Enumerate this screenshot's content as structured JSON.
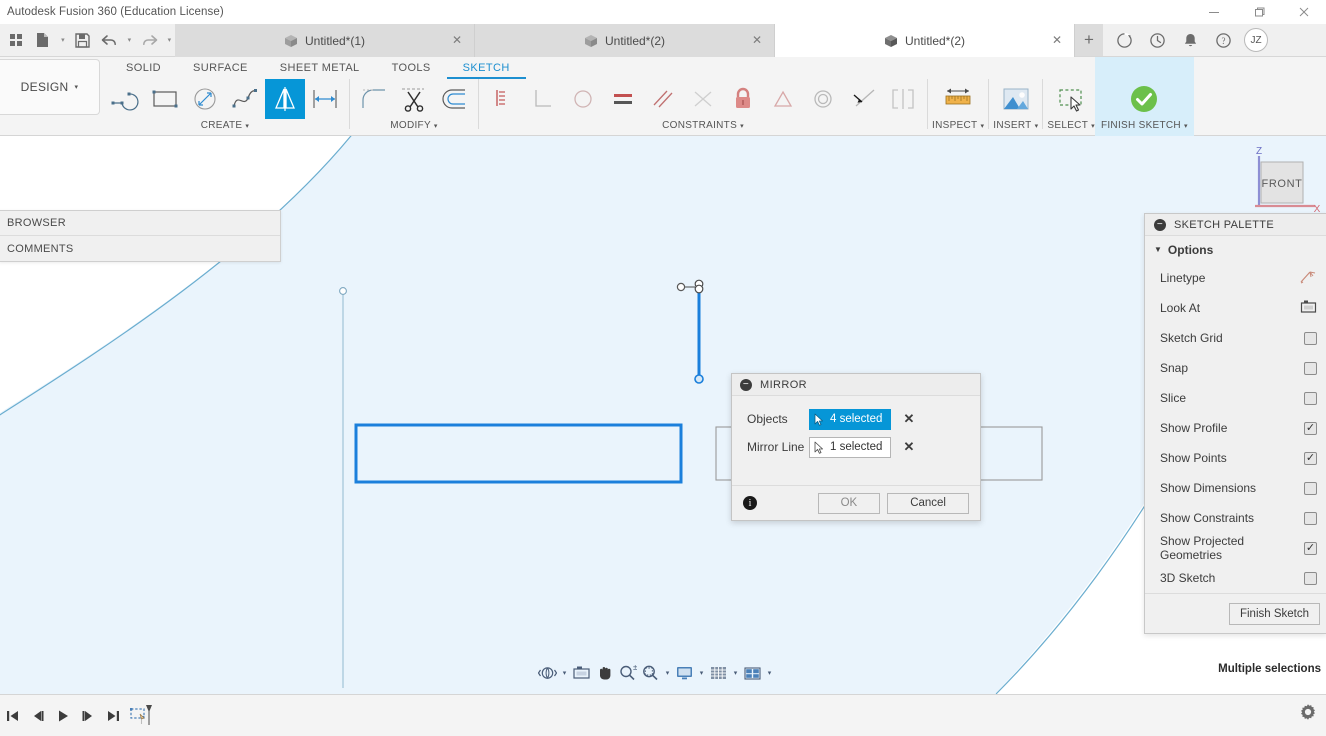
{
  "window": {
    "title": "Autodesk Fusion 360 (Education License)",
    "minimize": "—",
    "maximize": "❐",
    "close": "✕"
  },
  "quick_access": {
    "grid_label": "grid-menu-icon",
    "new_label": "new-document-icon",
    "save_label": "save-icon",
    "undo_label": "undo-icon",
    "redo_label": "redo-icon",
    "caret": "▾"
  },
  "tabs": [
    {
      "label": "Untitled*(1)",
      "active": false,
      "close": "✕"
    },
    {
      "label": "Untitled*(2)",
      "active": false,
      "close": "✕"
    },
    {
      "label": "Untitled*(2)",
      "active": true,
      "close": "✕"
    }
  ],
  "tab_actions": {
    "new_tab": "+",
    "job_status_icon": "job-status-icon",
    "recent_icon": "recent-icon",
    "notifications_icon": "notifications-icon",
    "help_icon": "help-icon",
    "avatar_initials": "JZ"
  },
  "ribbon": {
    "workspace": "DESIGN",
    "workspace_caret": "▾",
    "tabs": [
      {
        "label": "SOLID",
        "active": false
      },
      {
        "label": "SURFACE",
        "active": false
      },
      {
        "label": "SHEET METAL",
        "active": false
      },
      {
        "label": "TOOLS",
        "active": false
      },
      {
        "label": "SKETCH",
        "active": true
      }
    ],
    "groups": [
      {
        "label": "CREATE",
        "caret": "▾",
        "tools": [
          {
            "name": "line-tool",
            "selected": false
          },
          {
            "name": "rectangle-tool",
            "selected": false
          },
          {
            "name": "circle-tool",
            "selected": false
          },
          {
            "name": "spline-tool",
            "selected": false
          },
          {
            "name": "mirror-tool",
            "selected": true
          },
          {
            "name": "dimension-tool",
            "selected": false
          }
        ]
      },
      {
        "label": "MODIFY",
        "caret": "▾",
        "tools": [
          {
            "name": "fillet-tool",
            "selected": false
          },
          {
            "name": "trim-tool",
            "selected": false
          },
          {
            "name": "offset-tool",
            "selected": false
          }
        ]
      },
      {
        "label": "CONSTRAINTS",
        "caret": "▾",
        "tools": [
          {
            "name": "coincident-constraint",
            "selected": false
          },
          {
            "name": "perpendicular-constraint",
            "selected": false
          },
          {
            "name": "parallel-constraint",
            "selected": false
          },
          {
            "name": "tangent-constraint",
            "selected": false
          },
          {
            "name": "fix-unfix-constraint",
            "selected": false
          },
          {
            "name": "equal-constraint",
            "selected": false
          },
          {
            "name": "concentric-constraint",
            "selected": false
          },
          {
            "name": "collinear-constraint",
            "selected": false
          },
          {
            "name": "symmetry-constraint",
            "selected": false
          }
        ]
      },
      {
        "label": "INSPECT",
        "caret": "▾",
        "tools": [
          {
            "name": "measure-tool",
            "selected": false
          }
        ]
      },
      {
        "label": "INSERT",
        "caret": "▾",
        "tools": [
          {
            "name": "insert-image-tool",
            "selected": false
          }
        ]
      },
      {
        "label": "SELECT",
        "caret": "▾",
        "tools": [
          {
            "name": "select-tool",
            "selected": false
          }
        ]
      },
      {
        "label": "FINISH SKETCH",
        "caret": "▾",
        "tools": [
          {
            "name": "finish-sketch-tool",
            "selected": false
          }
        ]
      }
    ]
  },
  "left_panel": {
    "browser": "BROWSER",
    "comments": "COMMENTS"
  },
  "viewcube": {
    "face": "FRONT",
    "axis_z": "Z",
    "axis_x": "X"
  },
  "dialog": {
    "title": "MIRROR",
    "collapse": "−",
    "rows": [
      {
        "label": "Objects",
        "value": "4 selected",
        "active": true,
        "clear": "✕"
      },
      {
        "label": "Mirror Line",
        "value": "1 selected",
        "active": false,
        "clear": "✕"
      }
    ],
    "info": "i",
    "ok": "OK",
    "cancel": "Cancel"
  },
  "palette": {
    "title": "SKETCH PALETTE",
    "collapse": "−",
    "section": "Options",
    "section_caret": "▼",
    "rows": [
      {
        "label": "Linetype",
        "control": "icon",
        "icon": "linetype-icon",
        "checked": false
      },
      {
        "label": "Look At",
        "control": "icon",
        "icon": "look-at-icon",
        "checked": false
      },
      {
        "label": "Sketch Grid",
        "control": "checkbox",
        "checked": false
      },
      {
        "label": "Snap",
        "control": "checkbox",
        "checked": false
      },
      {
        "label": "Slice",
        "control": "checkbox",
        "checked": false
      },
      {
        "label": "Show Profile",
        "control": "checkbox",
        "checked": true
      },
      {
        "label": "Show Points",
        "control": "checkbox",
        "checked": true
      },
      {
        "label": "Show Dimensions",
        "control": "checkbox",
        "checked": false
      },
      {
        "label": "Show Constraints",
        "control": "checkbox",
        "checked": false
      },
      {
        "label": "Show Projected Geometries",
        "control": "checkbox",
        "checked": true
      },
      {
        "label": "3D Sketch",
        "control": "checkbox",
        "checked": false
      }
    ],
    "finish_button": "Finish Sketch"
  },
  "status": {
    "selection_text": "Multiple selections"
  },
  "navbar": {
    "items": [
      {
        "name": "orbit-icon",
        "caret": "▾"
      },
      {
        "name": "look-at-icon",
        "caret": ""
      },
      {
        "name": "pan-icon",
        "caret": ""
      },
      {
        "name": "zoom-icon",
        "caret": ""
      },
      {
        "name": "zoom-window-icon",
        "caret": "▾"
      },
      {
        "name": "display-settings-icon",
        "caret": "▾"
      },
      {
        "name": "grid-snaps-icon",
        "caret": "▾"
      },
      {
        "name": "viewports-icon",
        "caret": "▾"
      }
    ]
  },
  "timeline": {
    "buttons": [
      {
        "name": "timeline-start-icon",
        "glyph": "start"
      },
      {
        "name": "timeline-prev-icon",
        "glyph": "prev"
      },
      {
        "name": "timeline-play-icon",
        "glyph": "play"
      },
      {
        "name": "timeline-next-icon",
        "glyph": "next"
      },
      {
        "name": "timeline-end-icon",
        "glyph": "end"
      },
      {
        "name": "timeline-sketch-feature-icon",
        "glyph": "sketch"
      }
    ],
    "settings_icon": "settings-gear-icon"
  },
  "colors": {
    "accent_blue": "#0696d7",
    "selected_sketch": "#1b7fdb",
    "profile_fill": "#eaf4fc",
    "sketch_curve": "#6aadcf",
    "ribbon_bg": "#f4f4f4",
    "finish_bg": "#d7eefa",
    "green_check": "#6cc04a",
    "constraint_red": "#d46a6a"
  }
}
